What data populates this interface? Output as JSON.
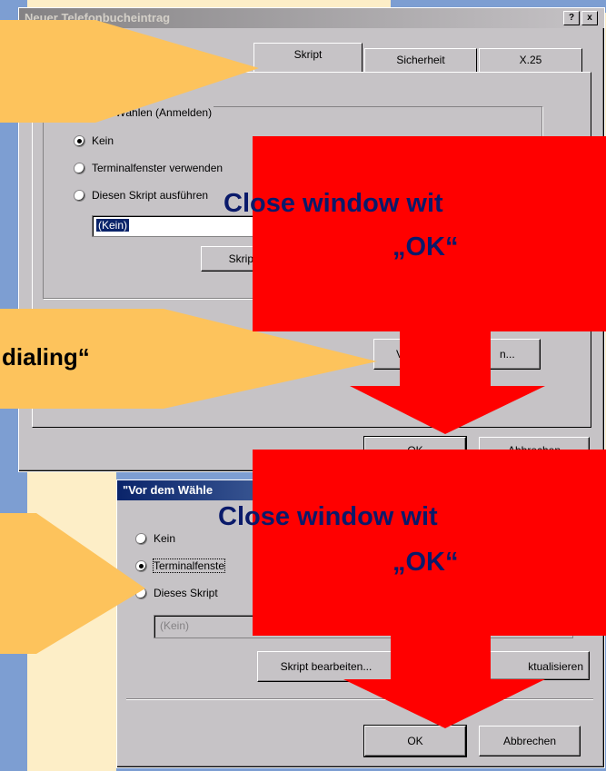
{
  "dialog_main": {
    "title": "Neuer Telefonbucheintrag",
    "help_btn": "?",
    "close_btn": "x",
    "tabs": [
      "Skript",
      "Sicherheit",
      "X.25"
    ],
    "group_label": "Nach dem Wählen (Anmelden)",
    "radios": [
      "Kein",
      "Terminalfenster verwenden",
      "Diesen Skript ausführen"
    ],
    "script_value": "(Kein)",
    "edit_script_btn": "Skript",
    "before_dial_btn_left": "V",
    "before_dial_btn_right": "n...",
    "ok_btn": "OK",
    "cancel_btn": "Abbrechen"
  },
  "dialog_sub": {
    "title": "\"Vor dem Wähle",
    "radios": [
      "Kein",
      "Terminalfenste",
      "Dieses Skript"
    ],
    "script_value": "(Kein)",
    "edit_script_btn": "Skript bearbeiten...",
    "refresh_btn": "ktualisieren",
    "ok_btn": "OK",
    "cancel_btn": "Abbrechen"
  },
  "callouts": {
    "dialing": "dialing“"
  },
  "overlays": {
    "close_top_line1": "Close window wit",
    "close_top_line2": "„OK“",
    "close_bottom_line1": "Close window wit",
    "close_bottom_line2": "„OK“"
  },
  "colors": {
    "callout": "#fdc35c",
    "overlay": "#ff0000",
    "overlay_text": "#0a1a6a"
  }
}
